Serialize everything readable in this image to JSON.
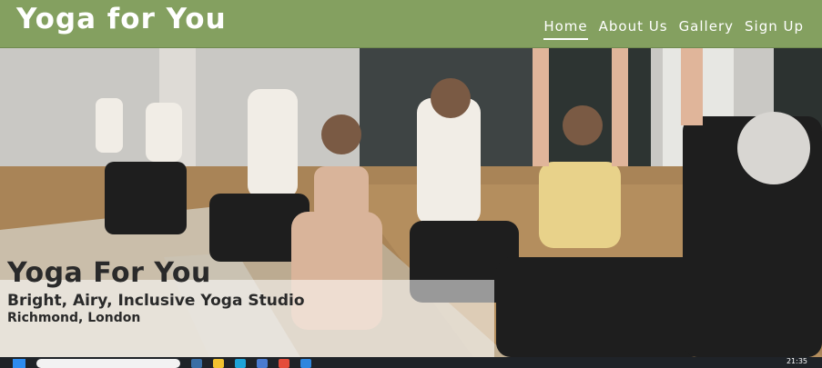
{
  "navbar": {
    "brand": "Yoga for You",
    "links": [
      {
        "label": "Home",
        "active": true
      },
      {
        "label": "About Us",
        "active": false
      },
      {
        "label": "Gallery",
        "active": false
      },
      {
        "label": "Sign Up",
        "active": false
      }
    ],
    "background_color": "#84a060"
  },
  "hero": {
    "image": "group-yoga-class-warrior-pose",
    "title": "Yoga For You",
    "subtitle": "Bright, Airy, Inclusive Yoga Studio",
    "location": "Richmond, London"
  },
  "taskbar": {
    "clock": "21:35",
    "icons": [
      "windows-start-icon",
      "search-box",
      "taskview-icon",
      "file-explorer-icon",
      "edge-icon",
      "store-icon",
      "chrome-icon",
      "mail-icon"
    ]
  }
}
